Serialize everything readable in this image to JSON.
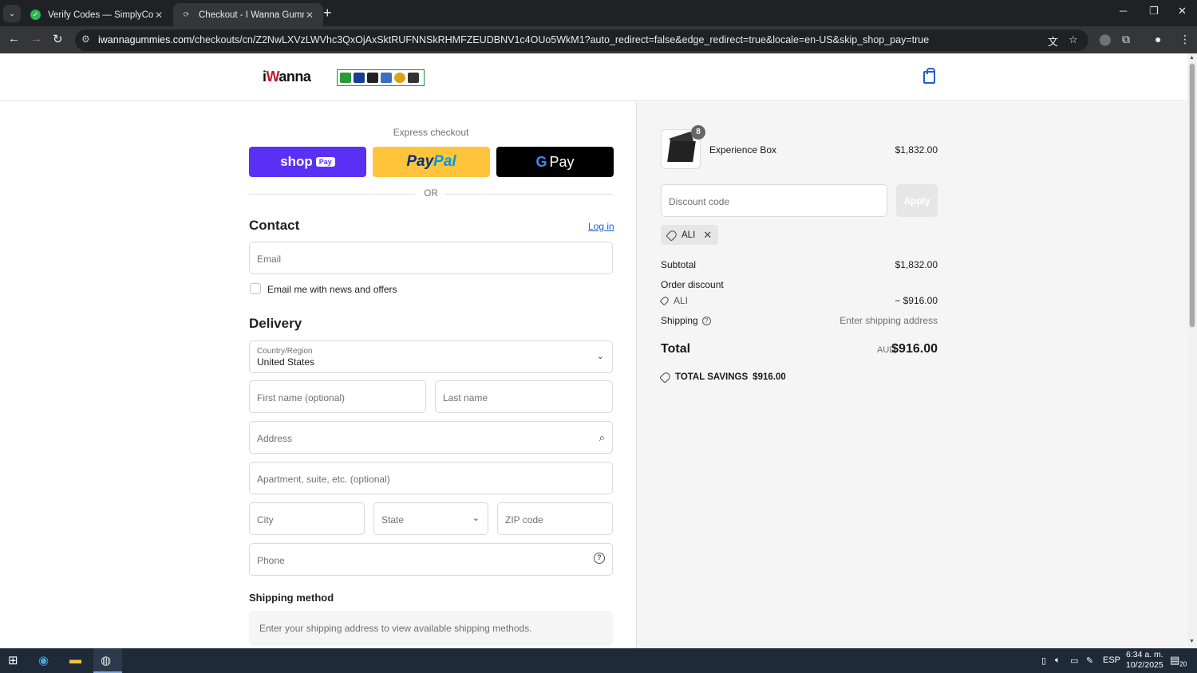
{
  "browser": {
    "tabs": [
      {
        "title": "Verify Codes — SimplyCodes",
        "active": false
      },
      {
        "title": "Checkout - I Wanna Gummies",
        "active": true
      }
    ],
    "url_domain": "iwannagummies.com",
    "url_rest": "/checkouts/cn/Z2NwLXVzLWVhc3QxOjAxSktRUFNNSkRHMFZEUDBNV1c4OUo5WkM1?auto_redirect=false&edge_redirect=true&locale=en-US&skip_shop_pay=true"
  },
  "header": {
    "logo_text_1": "i",
    "logo_text_2": "W",
    "logo_text_3": "anna"
  },
  "express": {
    "title": "Express checkout",
    "shop_label": "shop",
    "shop_tag": "Pay",
    "paypal_1": "Pay",
    "paypal_2": "Pal",
    "gpay_g": "G",
    "gpay_label": "Pay",
    "or": "OR"
  },
  "contact": {
    "heading": "Contact",
    "login": "Log in",
    "email_placeholder": "Email",
    "newsletter_label": "Email me with news and offers"
  },
  "delivery": {
    "heading": "Delivery",
    "country_label": "Country/Region",
    "country_value": "United States",
    "first_name": "First name (optional)",
    "last_name": "Last name",
    "address": "Address",
    "apartment": "Apartment, suite, etc. (optional)",
    "city": "City",
    "state": "State",
    "zip": "ZIP code",
    "phone": "Phone"
  },
  "shipping": {
    "heading": "Shipping method",
    "placeholder": "Enter your shipping address to view available shipping methods."
  },
  "summary": {
    "product": {
      "name": "Experience Box",
      "price": "$1,832.00",
      "quantity": "8"
    },
    "discount_placeholder": "Discount code",
    "apply": "Apply",
    "applied_code": "ALI",
    "subtotal_label": "Subtotal",
    "subtotal": "$1,832.00",
    "order_discount_label": "Order discount",
    "discount_code": "ALI",
    "discount_amount": "− $916.00",
    "shipping_label": "Shipping",
    "shipping_value": "Enter shipping address",
    "total_label": "Total",
    "currency": "AUD",
    "total": "$916.00",
    "savings_label": "TOTAL SAVINGS",
    "savings_value": "$916.00"
  },
  "taskbar": {
    "language": "ESP",
    "time": "6:34 a. m.",
    "date": "10/2/2025",
    "notif_count": "20"
  },
  "colors": {
    "shop_pay": "#5a31f4",
    "paypal": "#ffc439",
    "link": "#1c5fd6"
  }
}
